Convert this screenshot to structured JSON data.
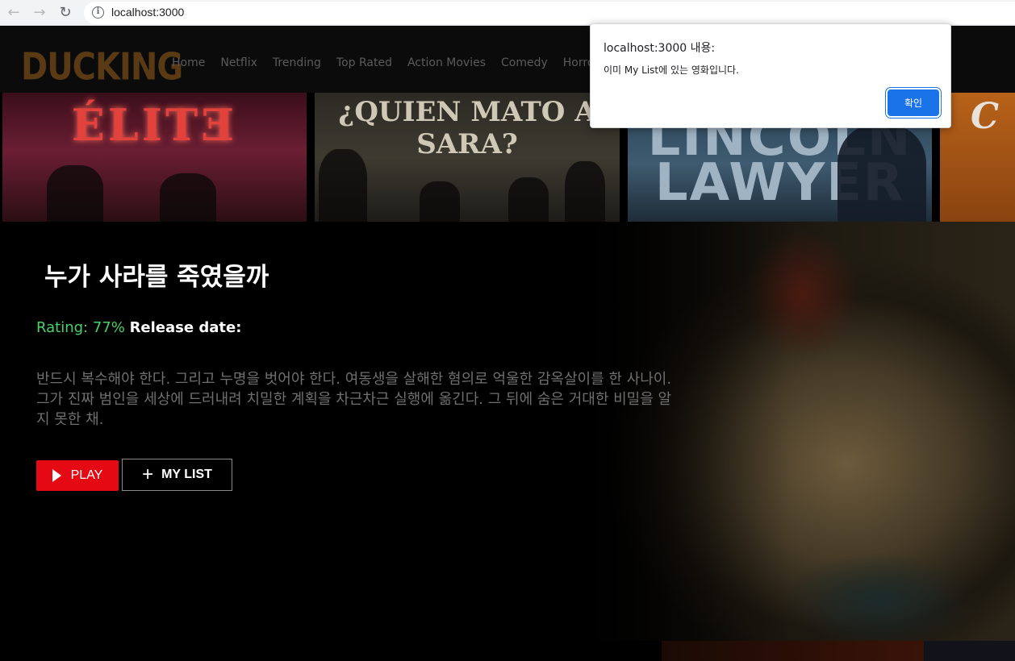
{
  "browser": {
    "url": "localhost:3000",
    "back_icon": "←",
    "forward_icon": "→",
    "reload_icon": "↻",
    "info_icon": "i"
  },
  "header": {
    "logo": "DUCKING",
    "menu": [
      "Home",
      "Netflix",
      "Trending",
      "Top Rated",
      "Action Movies",
      "Comedy",
      "Horror Movies"
    ]
  },
  "posters": [
    {
      "title": "ÉLITƎ"
    },
    {
      "title": "¿QUIEN MATO A SARA?"
    },
    {
      "title": "LINCOLN LAWYER"
    },
    {
      "title": "C"
    }
  ],
  "hero": {
    "title": "누가 사라를 죽였을까",
    "rating": "Rating: 77%",
    "release": "Release date:",
    "overview": "반드시 복수해야 한다. 그리고 누명을 벗어야 한다. 여동생을 살해한 혐의로 억울한 감옥살이를 한 사나이. 그가 진짜 범인을 세상에 드러내려 치밀한 계획을 차근차근 실행에 옮긴다. 그 뒤에 숨은 거대한 비밀을 알지 못한 채.",
    "play_label": "PLAY",
    "mylist_label": "MY LIST",
    "plus_icon": "+"
  },
  "dialog": {
    "title": "localhost:3000 내용:",
    "message": "이미 My List에 있는 영화입니다.",
    "ok_label": "확인"
  },
  "colors": {
    "accent_red": "#e50914",
    "rating_green": "#46d369",
    "dialog_button": "#1a73e8"
  }
}
